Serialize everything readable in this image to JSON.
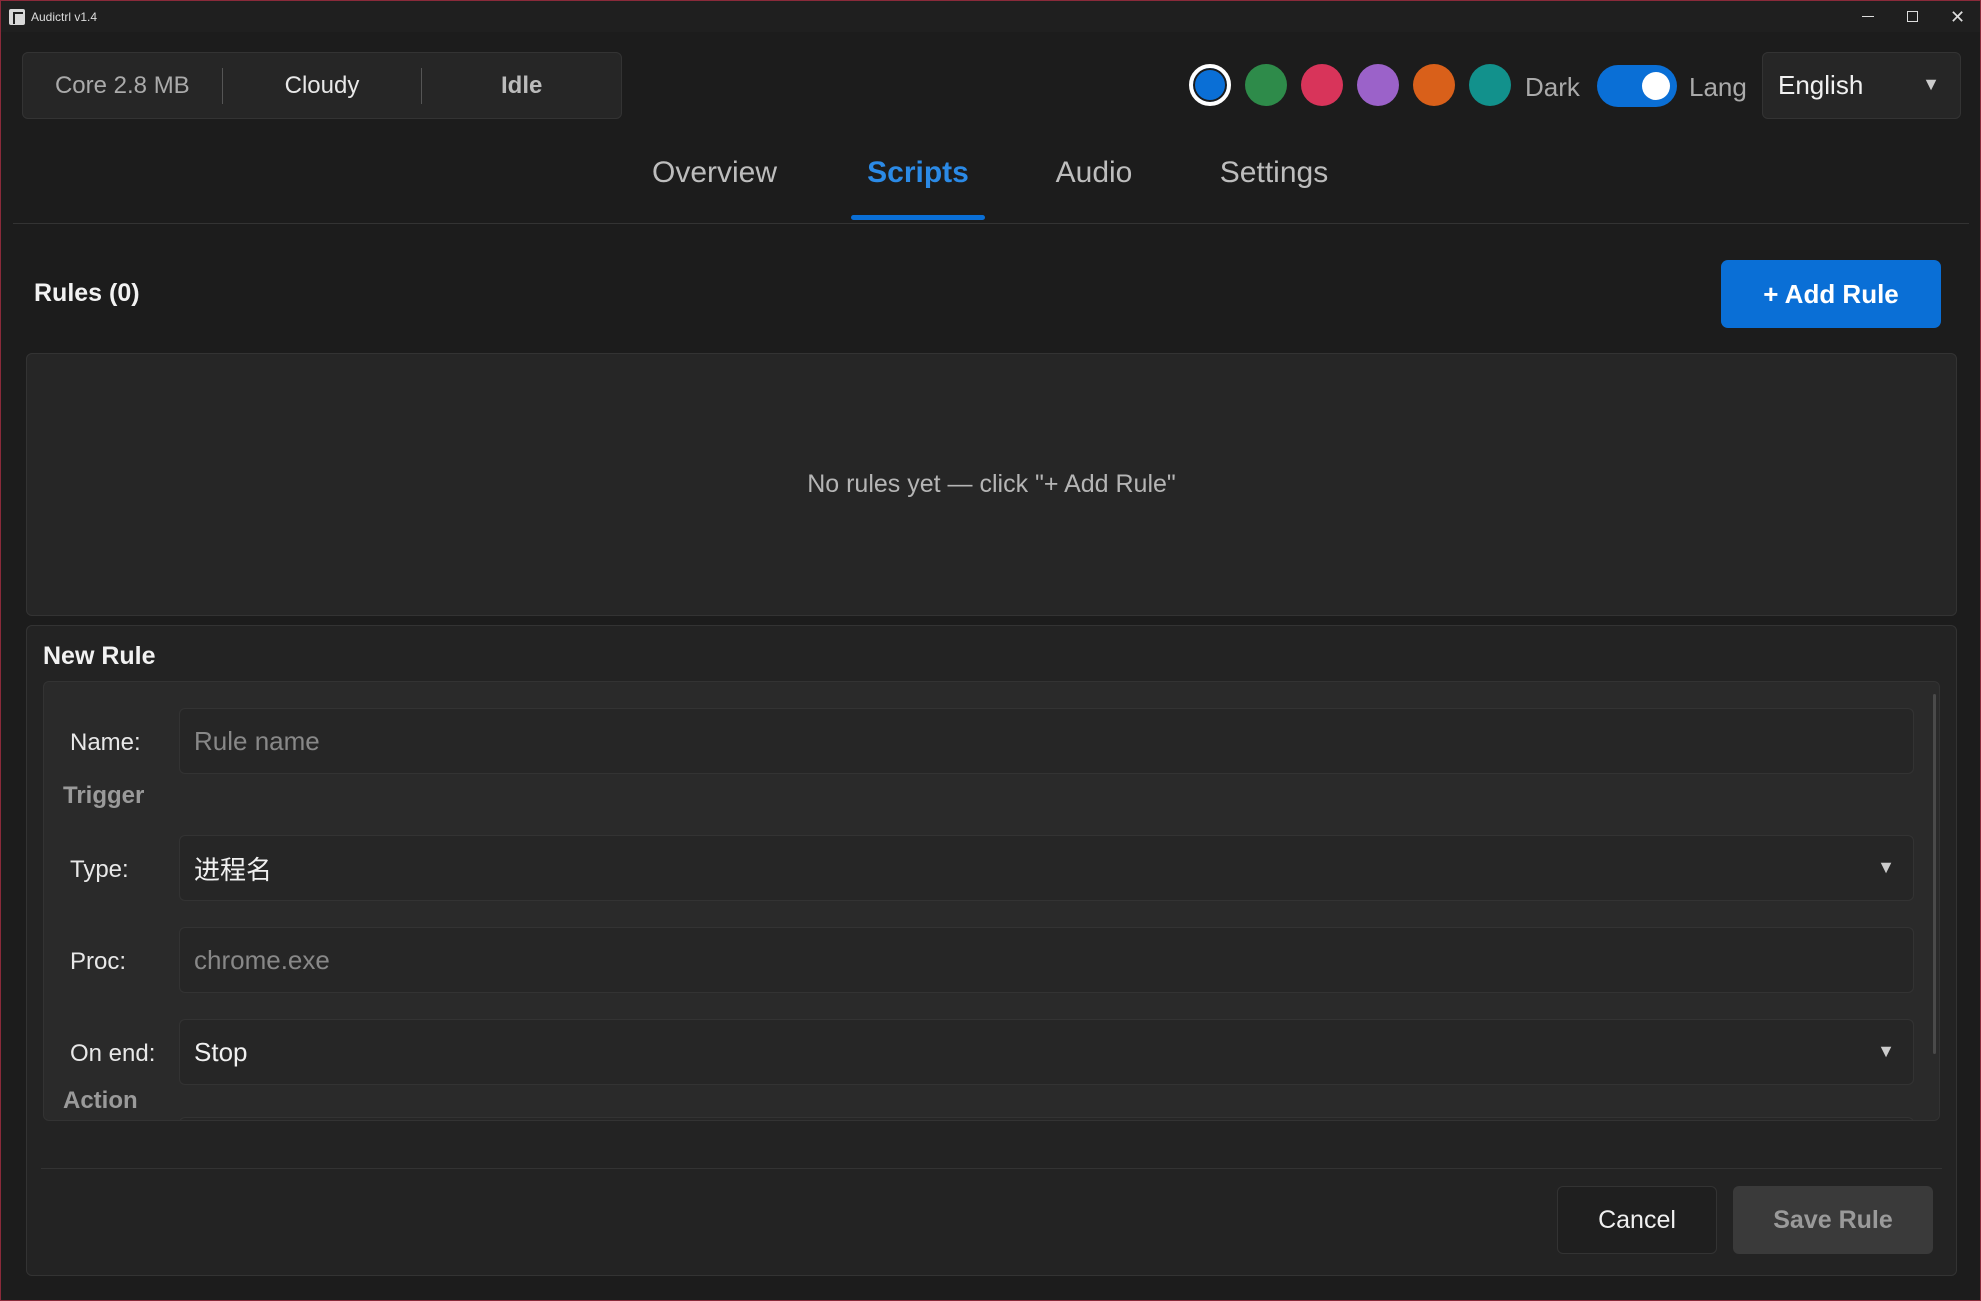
{
  "window": {
    "title": "Audictrl v1.4",
    "controls": [
      "minimize",
      "maximize",
      "close"
    ]
  },
  "status": {
    "core": "Core 2.8 MB",
    "weather": "Cloudy",
    "state": "Idle"
  },
  "theme": {
    "colors": [
      "#0a6fd6",
      "#2e8b4a",
      "#d8345a",
      "#9b62c9",
      "#d9601a",
      "#12918c"
    ],
    "selected_color": "#0a6fd6",
    "dark_label": "Dark",
    "dark_mode": true,
    "lang_label": "Lang",
    "language": "English"
  },
  "tabs": [
    {
      "label": "Overview",
      "active": false
    },
    {
      "label": "Scripts",
      "active": true
    },
    {
      "label": "Audio",
      "active": false
    },
    {
      "label": "Settings",
      "active": false
    }
  ],
  "rules": {
    "title": "Rules (0)",
    "add_button": "+ Add Rule",
    "empty_text": "No rules yet — click \"+ Add Rule\""
  },
  "new_rule": {
    "title": "New Rule",
    "name_label": "Name:",
    "name_placeholder": "Rule name",
    "trigger_section": "Trigger",
    "type_label": "Type:",
    "type_value": "进程名",
    "proc_label": "Proc:",
    "proc_placeholder": "chrome.exe",
    "on_end_label": "On end:",
    "on_end_value": "Stop",
    "action_section": "Action",
    "cancel_button": "Cancel",
    "save_button": "Save Rule"
  },
  "accent_color": "#0a6fd6"
}
